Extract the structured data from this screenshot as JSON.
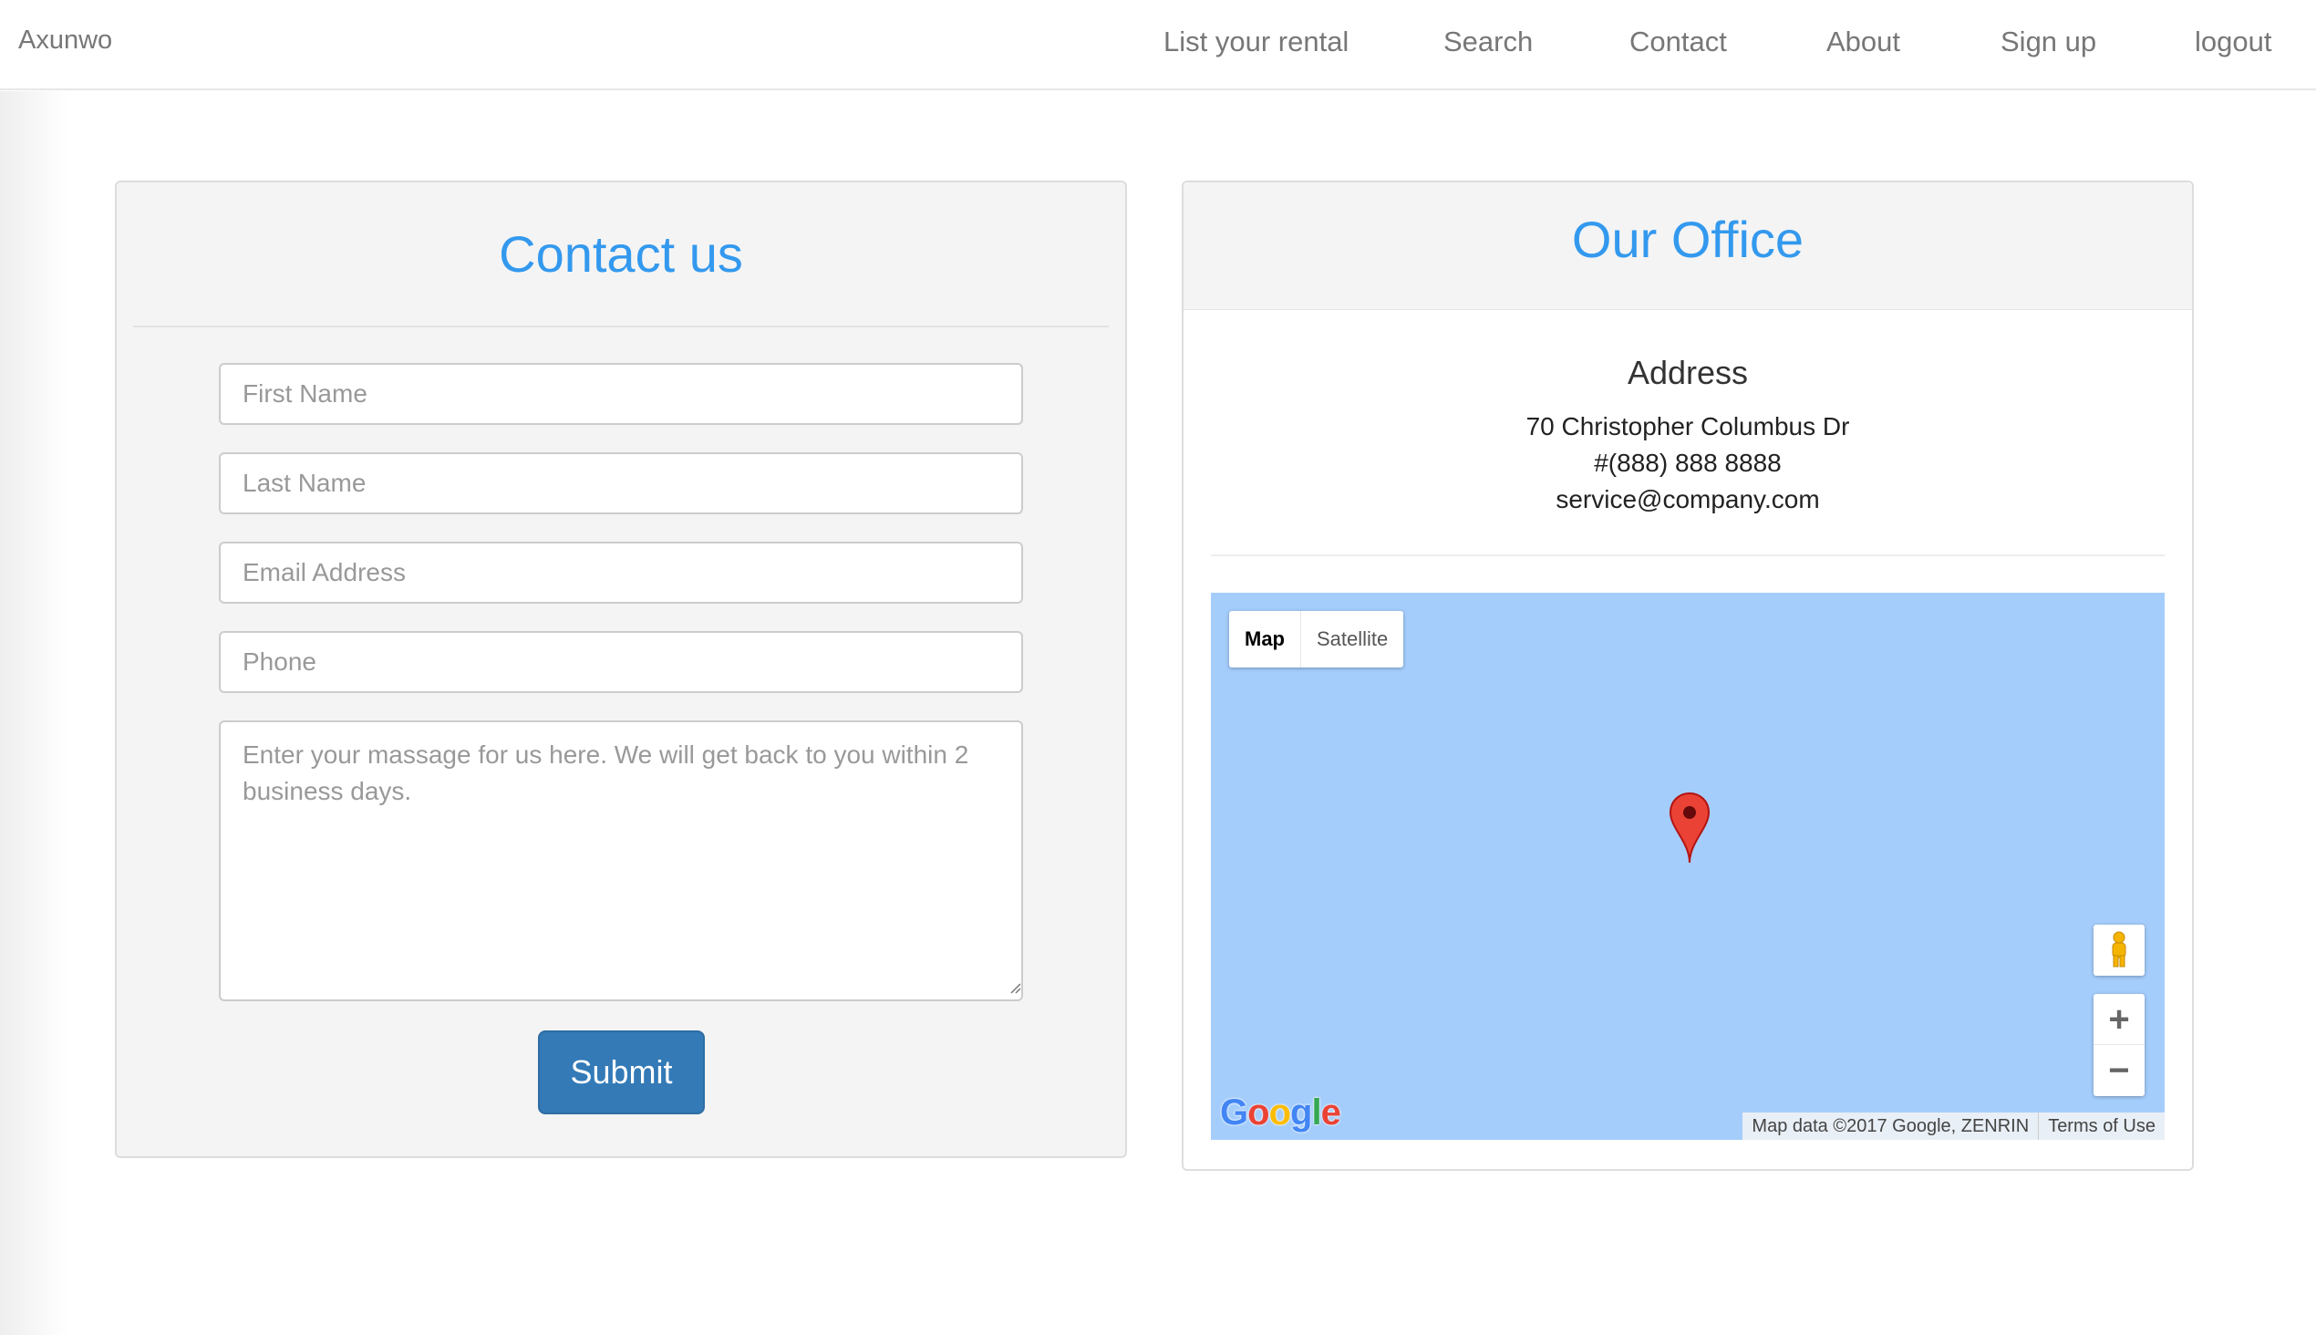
{
  "brand": "Axunwo",
  "nav": {
    "items": [
      "List your rental",
      "Search",
      "Contact",
      "About",
      "Sign up",
      "logout"
    ]
  },
  "contact": {
    "title": "Contact us",
    "first_name_placeholder": "First Name",
    "last_name_placeholder": "Last Name",
    "email_placeholder": "Email Address",
    "phone_placeholder": "Phone",
    "message_placeholder": "Enter your massage for us here. We will get back to you within 2 business days.",
    "submit_label": "Submit"
  },
  "office": {
    "title": "Our Office",
    "address_heading": "Address",
    "street": "70 Christopher Columbus Dr",
    "phone": "#(888) 888 8888",
    "email": "service@company.com"
  },
  "map": {
    "type_map_label": "Map",
    "type_satellite_label": "Satellite",
    "active_type": "Map",
    "zoom_in_label": "+",
    "zoom_out_label": "−",
    "logo_text": "Google",
    "attribution": "Map data ©2017 Google, ZENRIN",
    "terms": "Terms of Use",
    "water_color": "#a5cdfc",
    "pin_color": "#ea4335"
  },
  "colors": {
    "accent": "#3399ee",
    "button": "#337ab7",
    "nav_text": "#777777"
  }
}
